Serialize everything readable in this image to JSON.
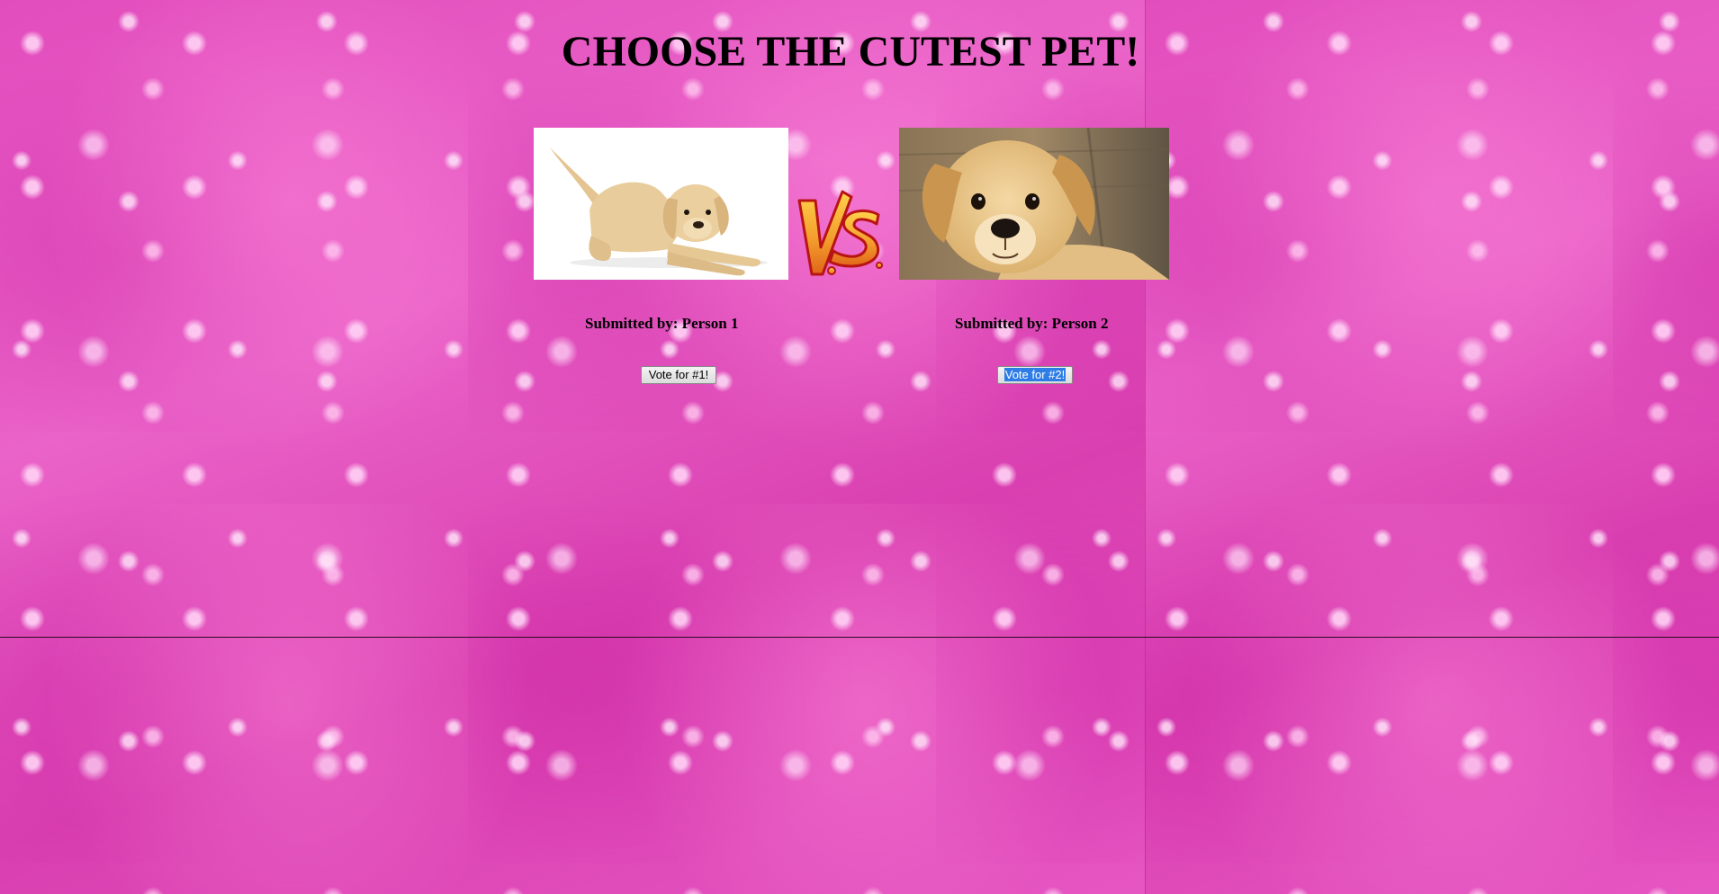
{
  "page": {
    "title": "CHOOSE THE CUTEST PET!"
  },
  "contest": {
    "vs_label": "VS",
    "pets": [
      {
        "submitted_by": "Submitted by: Person 1",
        "vote_label": "Vote for #1!"
      },
      {
        "submitted_by": "Submitted by: Person 2",
        "vote_label": "Vote for #2!"
      }
    ]
  },
  "colors": {
    "background": "#e04bb8",
    "vs_fill": "#f0a030",
    "vs_outline": "#c01818",
    "selection": "#2e7de6"
  }
}
